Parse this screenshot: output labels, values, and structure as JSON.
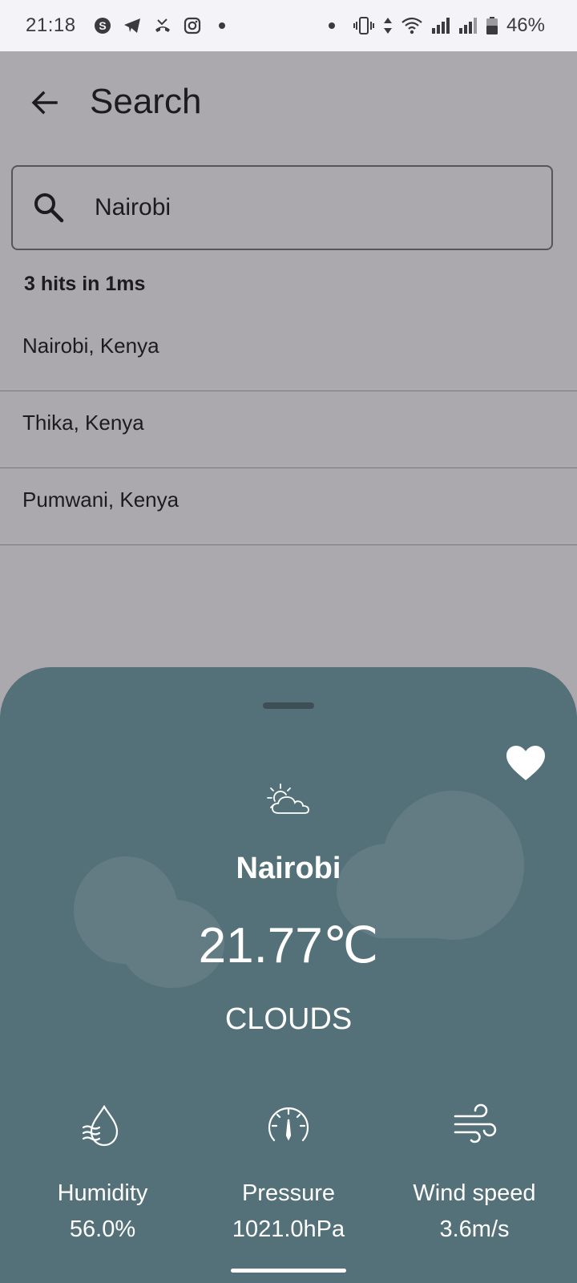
{
  "status_bar": {
    "time": "21:18",
    "battery_percent": "46%",
    "left_icons": [
      "skype-icon",
      "telegram-icon",
      "missed-call-icon",
      "instagram-icon"
    ],
    "right_icons": [
      "vibrate-icon",
      "data-arrows-icon",
      "wifi-icon",
      "signal-icon",
      "signal-icon-2",
      "battery-icon"
    ]
  },
  "app_bar": {
    "title": "Search"
  },
  "search": {
    "value": "Nairobi",
    "hits_text": "3 hits in 1ms"
  },
  "results": [
    {
      "label": "Nairobi, Kenya"
    },
    {
      "label": "Thika, Kenya"
    },
    {
      "label": "Pumwani, Kenya"
    }
  ],
  "weather": {
    "city": "Nairobi",
    "temperature": "21.77℃",
    "condition": "CLOUDS",
    "icon": "partly-cloudy-icon",
    "stats": [
      {
        "label": "Humidity",
        "value": "56.0%",
        "icon": "humidity-icon"
      },
      {
        "label": "Pressure",
        "value": "1021.0hPa",
        "icon": "pressure-gauge-icon"
      },
      {
        "label": "Wind speed",
        "value": "3.6m/s",
        "icon": "wind-icon"
      }
    ]
  },
  "colors": {
    "sheet_background": "#54717a",
    "scrim_background": "#aba9ad",
    "status_bar": "#f4f3f8"
  }
}
